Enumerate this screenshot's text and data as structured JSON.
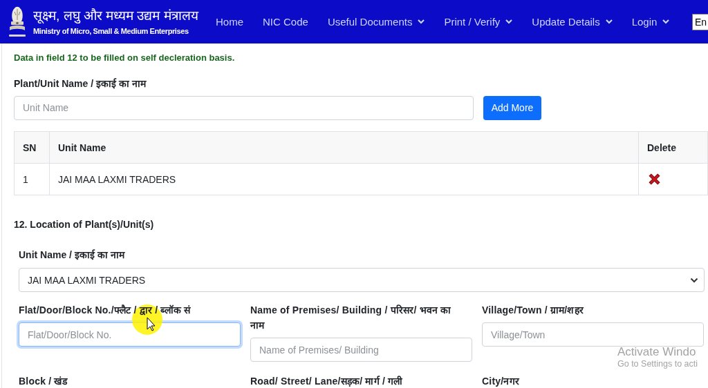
{
  "header": {
    "ministry_hindi": "सूक्ष्म, लघु और मध्यम उद्यम मंत्रालय",
    "ministry_english": "Ministry of Micro, Small & Medium Enterprises",
    "nav": [
      {
        "label": "Home",
        "dropdown": false
      },
      {
        "label": "NIC Code",
        "dropdown": false
      },
      {
        "label": "Useful Documents",
        "dropdown": true
      },
      {
        "label": "Print / Verify",
        "dropdown": true
      },
      {
        "label": "Update Details",
        "dropdown": true
      },
      {
        "label": "Login",
        "dropdown": true
      }
    ],
    "language_select": {
      "value": "En"
    }
  },
  "notice": "Data in field 12 to be filled on self decleration basis.",
  "unit_entry": {
    "label": "Plant/Unit Name / इकाई का नाम",
    "field": {
      "placeholder": "Unit Name"
    },
    "button": "Add More"
  },
  "units_table": {
    "columns": [
      "SN",
      "Unit Name",
      "Delete"
    ],
    "rows": [
      {
        "sn": "1",
        "unit_name": "JAI MAA LAXMI TRADERS"
      }
    ]
  },
  "location": {
    "heading": "12. Location of Plant(s)/Unit(s)",
    "unit_select": {
      "label": "Unit Name / इकाई का नाम",
      "value": "JAI MAA LAXMI TRADERS"
    },
    "fields": [
      {
        "label": "Flat/Door/Block No./फ्लैट / द्वार / ब्लॉक सं",
        "placeholder": "Flat/Door/Block No.",
        "focused": true
      },
      {
        "label": "Name of Premises/ Building / परिसर/ भवन का नाम",
        "placeholder": "Name of Premises/ Building",
        "focused": false
      },
      {
        "label": "Village/Town / ग्राम/शहर",
        "placeholder": "Village/Town",
        "focused": false
      },
      {
        "label": "Block / खंड"
      },
      {
        "label": "Road/ Street/ Lane/सड़क/ मार्ग / गली"
      },
      {
        "label": "City/नगर"
      }
    ]
  },
  "activation_notice": {
    "title": "Activate Windo",
    "text": "Go to Settings to acti"
  }
}
